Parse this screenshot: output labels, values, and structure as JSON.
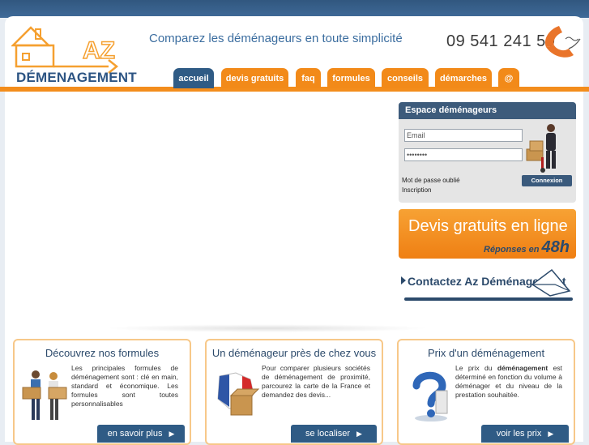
{
  "logo": {
    "letters": "AZ",
    "subtitle": "DÉMENAGEMENT"
  },
  "header": {
    "tagline": "Comparez les déménageurs en toute simplicité",
    "phone": "09 541 241 50"
  },
  "nav": {
    "tabs": [
      {
        "label": "accueil"
      },
      {
        "label": "devis gratuits"
      },
      {
        "label": "faq"
      },
      {
        "label": "formules"
      },
      {
        "label": "conseils"
      },
      {
        "label": "démarches"
      },
      {
        "label": "@"
      }
    ]
  },
  "espace": {
    "title": "Espace déménageurs",
    "email_placeholder": "Email",
    "password_value": "••••••••",
    "forgot": "Mot de passe oublié",
    "inscription": "Inscription",
    "connexion": "Connexion"
  },
  "devis_banner": {
    "title": "Devis gratuits en ligne",
    "sub_prefix": "Réponses en",
    "sub_hours": "48h"
  },
  "contact": {
    "label": "Contactez Az Déménagement"
  },
  "cards": [
    {
      "title": "Découvrez nos formules",
      "text": "Les principales formules de déménagement sont : clé en main, standard et économique. Les formules sont toutes personnalisables",
      "button": "en savoir plus"
    },
    {
      "title": "Un déménageur près de chez vous",
      "text": "Pour comparer plusieurs sociétés de déménagement de proximité, parcourez la carte de la France et demandez des devis...",
      "button": "se localiser"
    },
    {
      "title": "Prix d'un déménagement",
      "text_a": "Le prix du ",
      "text_b": "déménagement",
      "text_c": " est déterminé en fonction du volume à déménager et du niveau de la prestation souhaitée.",
      "button": "voir les prix"
    }
  ],
  "colors": {
    "orange": "#f28a19",
    "navy": "#2f5b85",
    "header_blue": "#3b6d9f"
  }
}
